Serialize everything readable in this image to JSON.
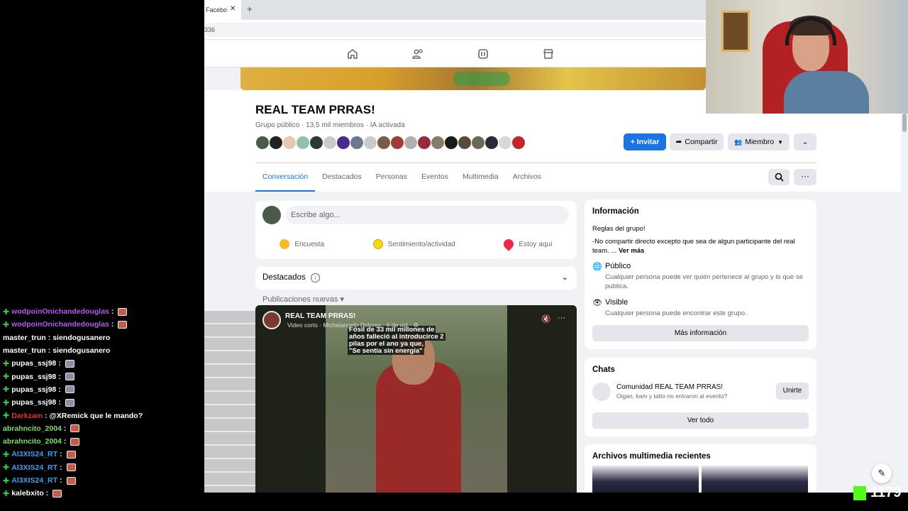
{
  "browser": {
    "tab_label": "Facebo",
    "tab_close": "✕",
    "new_tab": "+",
    "url_fragment": "336"
  },
  "fb_nav": {
    "icons": [
      "home-icon",
      "friends-icon",
      "watch-icon",
      "marketplace-icon"
    ]
  },
  "group": {
    "title": "REAL TEAM PRRAS!",
    "meta": "Grupo público · 13,5 mil miembros · IA activada",
    "invite_label": "+ Invitar",
    "share_label": "Compartir",
    "member_label": "Miembro",
    "more_label": "⌄"
  },
  "tabs": [
    "Conversación",
    "Destacados",
    "Personas",
    "Eventos",
    "Multimedia",
    "Archivos"
  ],
  "composer": {
    "placeholder": "Escribe algo...",
    "actions": [
      "Encuesta",
      "Sentimiento/actividad",
      "Estoy aquí"
    ]
  },
  "destacados": {
    "label": "Destacados",
    "info": "i"
  },
  "new_posts": "Publicaciones nuevas ▾",
  "video_post": {
    "author": "REAL TEAM PRRAS!",
    "sub": "Video corto · Michelangelo Dolores · 6 de oct · ⚙",
    "caption": [
      "Fósil de 33 mil millones de",
      "años falleció al introducirce 2",
      "pilas por el ano ya que,",
      "\"Se sentía sin energía\""
    ]
  },
  "info_card": {
    "title": "Información",
    "rules_title": "Reglas del grupo!",
    "rules_text": "-No compartir directo excepto que sea de algun participante del real team. ...",
    "see_more": "Ver más",
    "public_title": "Público",
    "public_desc": "Cualquier persona puede ver quién pertenece al grupo y lo que se publica.",
    "visible_title": "Visible",
    "visible_desc": "Cualquier persona puede encontrar este grupo.",
    "more_info": "Más información"
  },
  "chats_card": {
    "title": "Chats",
    "chat_name": "Comunidad REAL TEAM PRRAS!",
    "chat_sub": "Oigan, kam y tatto no entraron al evento?",
    "join": "Unirte",
    "see_all": "Ver todo"
  },
  "media_card": {
    "title": "Archivos multimedia recientes"
  },
  "stream_chat": [
    {
      "user": "wodpoinOnichandedouglas",
      "color": "#b45cf0",
      "msg": "",
      "emote": "red",
      "plus": true
    },
    {
      "user": "wodpoinOnichandedouglas",
      "color": "#b45cf0",
      "msg": "",
      "emote": "red",
      "plus": true
    },
    {
      "user": "master_trun",
      "color": "#ffffff",
      "msg": "siendogusanero",
      "emote": "",
      "plus": false
    },
    {
      "user": "master_trun",
      "color": "#ffffff",
      "msg": "siendogusanero",
      "emote": "",
      "plus": false
    },
    {
      "user": "pupas_ssj98",
      "color": "#ffffff",
      "msg": "",
      "emote": "ghost",
      "plus": true
    },
    {
      "user": "pupas_ssj98",
      "color": "#ffffff",
      "msg": "",
      "emote": "ghost",
      "plus": true
    },
    {
      "user": "pupas_ssj98",
      "color": "#ffffff",
      "msg": "",
      "emote": "ghost",
      "plus": true
    },
    {
      "user": "pupas_ssj98",
      "color": "#ffffff",
      "msg": "",
      "emote": "ghost",
      "plus": true
    },
    {
      "user": "Darkzam",
      "color": "#e0342e",
      "msg": "@XRemick que le mando?",
      "emote": "",
      "plus": true
    },
    {
      "user": "abrahncito_2004",
      "color": "#7ee06a",
      "msg": "",
      "emote": "red",
      "plus": false
    },
    {
      "user": "abrahncito_2004",
      "color": "#7ee06a",
      "msg": "",
      "emote": "red",
      "plus": false
    },
    {
      "user": "Al3XIS24_RT",
      "color": "#3fa0f0",
      "msg": "",
      "emote": "red",
      "plus": true
    },
    {
      "user": "Al3XIS24_RT",
      "color": "#3fa0f0",
      "msg": "",
      "emote": "red",
      "plus": true
    },
    {
      "user": "Al3XIS24_RT",
      "color": "#3fa0f0",
      "msg": "",
      "emote": "red",
      "plus": true
    },
    {
      "user": "kalebxito",
      "color": "#ffffff",
      "msg": "",
      "emote": "red",
      "plus": true
    }
  ],
  "kick_viewers": "1179",
  "colors": {
    "fb_blue": "#1b74e4",
    "bg": "#f0f2f5"
  }
}
